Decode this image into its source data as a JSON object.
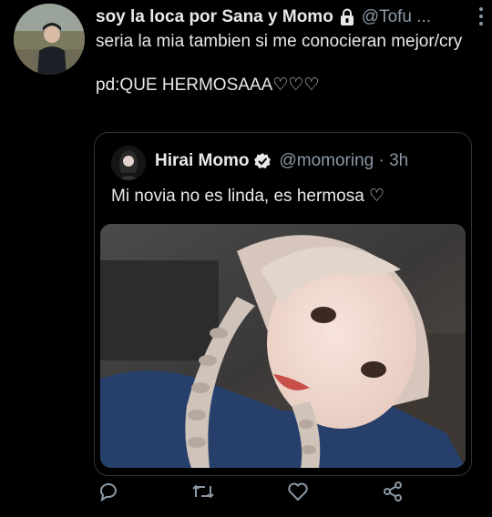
{
  "tweet": {
    "author_name": "soy la loca por Sana y Momo",
    "author_handle": "@Tofu ...",
    "text": "seria la mia tambien si me conocieran mejor/cry\n\npd:QUE HERMOSAAA♡♡♡",
    "locked_icon": "lock-icon",
    "more_icon": "more-vertical-icon"
  },
  "quoted": {
    "author_name": "Hirai Momo",
    "handle_time": "@momoring · 3h",
    "text": "Mi novia no es linda, es hermosa ♡",
    "verified_icon": "verified-badge-icon"
  },
  "actions": {
    "icons": [
      "reply-icon",
      "retweet-icon",
      "like-icon",
      "share-icon"
    ]
  },
  "colors": {
    "background": "#000000",
    "text": "#e7e9ea",
    "secondary": "#8b98a5",
    "border": "#2f3336"
  }
}
